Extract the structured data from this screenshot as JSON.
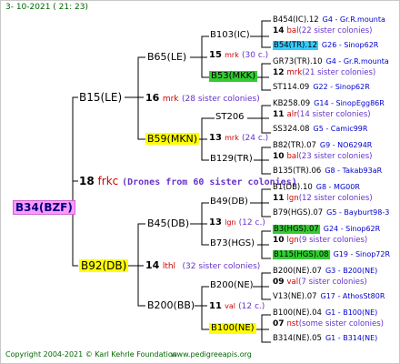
{
  "header": {
    "date": "3- 10-2021 ( 21: 23)"
  },
  "footer": {
    "copyright": "Copyright 2004-2021 © Karl Kehrle Foundation",
    "site": "www.pedigreeapis.org"
  },
  "root": {
    "name": "B34(BZF)",
    "color": "#ff99ff"
  },
  "gen1": {
    "sire": {
      "name": "B15(LE)"
    },
    "drone_info": {
      "num": "18",
      "code": "frkc",
      "desc": "(Drones from 60 sister colonies)"
    },
    "dam": {
      "name": "B92(DB)",
      "color": "#ffff00"
    }
  },
  "gen2": [
    {
      "name": "B65(LE)"
    },
    {
      "num": "16",
      "code": "mrk",
      "desc": "(28 sister colonies)"
    },
    {
      "name": "B59(MKN)",
      "color": "#ffff00"
    },
    {
      "name": "B45(DB)"
    },
    {
      "num": "14",
      "code": "lthl",
      "desc": "(32 sister colonies)"
    },
    {
      "name": "B200(BB)"
    }
  ],
  "gen3": [
    {
      "name": "B103(IC)"
    },
    {
      "num": "15",
      "code": "mrk",
      "desc": "(30 c.)"
    },
    {
      "name": "B53(MKK)",
      "color": "#33cc33"
    },
    {
      "name": "ST206"
    },
    {
      "num": "13",
      "code": "mrk",
      "desc": "(24 c.)"
    },
    {
      "name": "B129(TR)"
    },
    {
      "name": "B49(DB)"
    },
    {
      "num": "13",
      "code": "lgn",
      "desc": "(12 c.)"
    },
    {
      "name": "B73(HGS)"
    },
    {
      "name": "B200(NE)"
    },
    {
      "num": "11",
      "code": "val",
      "desc": "(12 c.)"
    },
    {
      "name": "B100(NE)",
      "color": "#ffff00"
    }
  ],
  "gen4": [
    {
      "name": "B454(IC).12",
      "info": "G4 - Gr.R.mounta"
    },
    {
      "num": "14",
      "code": "bal",
      "desc": "(22 sister colonies)"
    },
    {
      "name": "B54(TR).12",
      "info": "G26 - Sinop62R",
      "color": "#33ccff"
    },
    {
      "name": "GR73(TR).10",
      "info": "G4 - Gr.R.mounta"
    },
    {
      "num": "12",
      "code": "mrk",
      "desc": "(21 sister colonies)"
    },
    {
      "name": "ST114.09",
      "info": "G22 - Sinop62R"
    },
    {
      "name": "KB258.09",
      "info": "G14 - SinopEgg86R"
    },
    {
      "num": "11",
      "code": "alr",
      "desc": "(14 sister colonies)"
    },
    {
      "name": "SS324.08",
      "info": "G5 - Camic99R"
    },
    {
      "name": "B82(TR).07",
      "info": "G9 - NO6294R"
    },
    {
      "num": "10",
      "code": "bal",
      "desc": "(23 sister colonies)"
    },
    {
      "name": "B135(TR).06",
      "info": "G8 - Takab93aR"
    },
    {
      "name": "B1(DB).10",
      "info": "G8 - MG00R"
    },
    {
      "num": "11",
      "code": "lgn",
      "desc": "(12 sister colonies)"
    },
    {
      "name": "B79(HGS).07",
      "info": "G5 - Bayburt98-3"
    },
    {
      "name": "B3(HGS).07",
      "info": "G24 - Sinop62R",
      "color": "#33cc33"
    },
    {
      "num": "10",
      "code": "lgn",
      "desc": "(9 sister colonies)"
    },
    {
      "name": "B115(HGS).08",
      "info": "G19 - Sinop72R",
      "color": "#33cc33"
    },
    {
      "name": "B200(NE).07",
      "info": "G3 - B200(NE)"
    },
    {
      "num": "09",
      "code": "val",
      "desc": "(7 sister colonies)"
    },
    {
      "name": "V13(NE).07",
      "info": "G17 - AthosSt80R"
    },
    {
      "name": "B100(NE).04",
      "info": "G1 - B100(NE)"
    },
    {
      "num": "07",
      "code": "nst",
      "desc": "(some sister colonies)"
    },
    {
      "name": "B314(NE).05",
      "info": "G1 - B314(NE)"
    }
  ],
  "colors": {
    "num": "#000000",
    "code": "#cc0000",
    "desc": "#6633cc",
    "info": "#0000cc",
    "header": "#006600"
  }
}
